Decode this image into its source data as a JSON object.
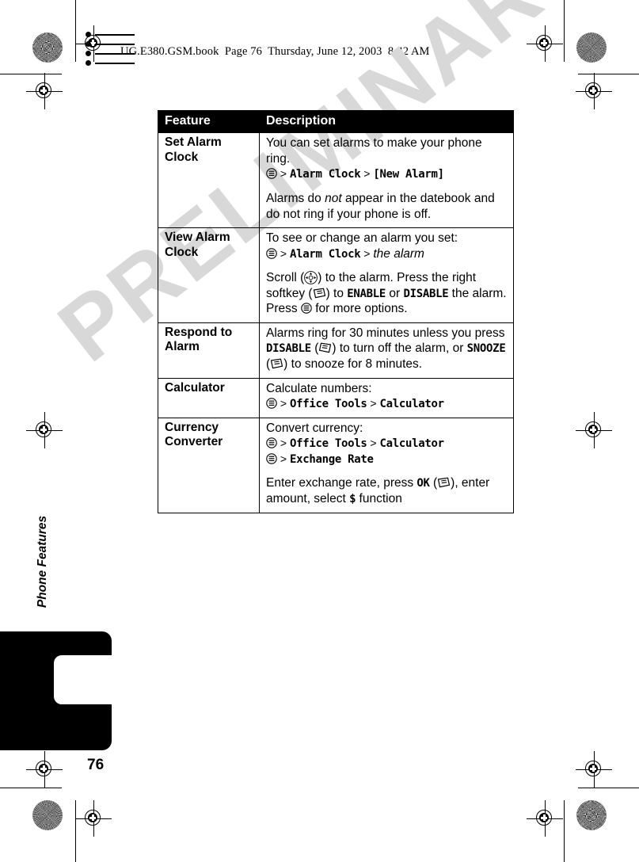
{
  "document": {
    "header_line": "UG.E380.GSM.book  Page 76  Thursday, June 12, 2003  8:42 AM",
    "watermark": "PRELIMINARY",
    "page_number": "76",
    "side_label": "Phone Features"
  },
  "table": {
    "headers": [
      "Feature",
      "Description"
    ],
    "rows": [
      {
        "feature": "Set Alarm Clock",
        "paragraphs": [
          {
            "segments": [
              {
                "type": "text",
                "value": "You can set alarms to make your phone ring."
              },
              {
                "type": "break"
              },
              {
                "type": "icon",
                "value": "menu-icon"
              },
              {
                "type": "sep",
                "value": " > "
              },
              {
                "type": "phone",
                "value": "Alarm Clock"
              },
              {
                "type": "sep",
                "value": " > "
              },
              {
                "type": "phone",
                "value": "[New Alarm]"
              }
            ]
          },
          {
            "segments": [
              {
                "type": "text",
                "value": "Alarms do "
              },
              {
                "type": "italic",
                "value": "not"
              },
              {
                "type": "text",
                "value": " appear in the datebook and do not ring if your phone is off."
              }
            ]
          }
        ]
      },
      {
        "feature": "View Alarm Clock",
        "paragraphs": [
          {
            "segments": [
              {
                "type": "text",
                "value": "To see or change an alarm you set:"
              },
              {
                "type": "break"
              },
              {
                "type": "icon",
                "value": "menu-icon"
              },
              {
                "type": "sep",
                "value": " > "
              },
              {
                "type": "phone",
                "value": "Alarm Clock"
              },
              {
                "type": "sep",
                "value": " > "
              },
              {
                "type": "italic",
                "value": "the alarm"
              }
            ]
          },
          {
            "segments": [
              {
                "type": "text",
                "value": "Scroll ("
              },
              {
                "type": "icon",
                "value": "nav-pad-icon"
              },
              {
                "type": "text",
                "value": ") to the alarm. Press the right softkey ("
              },
              {
                "type": "icon",
                "value": "right-softkey-icon"
              },
              {
                "type": "text",
                "value": ") to "
              },
              {
                "type": "phone",
                "value": "ENABLE"
              },
              {
                "type": "text",
                "value": " or "
              },
              {
                "type": "phone",
                "value": "DISABLE"
              },
              {
                "type": "text",
                "value": " the alarm. Press "
              },
              {
                "type": "icon",
                "value": "menu-icon"
              },
              {
                "type": "text",
                "value": " for more options."
              }
            ]
          }
        ]
      },
      {
        "feature": "Respond to Alarm",
        "paragraphs": [
          {
            "segments": [
              {
                "type": "text",
                "value": "Alarms ring for 30 minutes unless you press"
              },
              {
                "type": "break"
              },
              {
                "type": "phone",
                "value": "DISABLE"
              },
              {
                "type": "text",
                "value": " ("
              },
              {
                "type": "icon",
                "value": "left-softkey-icon"
              },
              {
                "type": "text",
                "value": ") to turn off the alarm, or "
              },
              {
                "type": "phone",
                "value": "SNOOZE"
              },
              {
                "type": "text",
                "value": " ("
              },
              {
                "type": "icon",
                "value": "right-softkey-icon"
              },
              {
                "type": "text",
                "value": ") to snooze for 8 minutes."
              }
            ]
          }
        ]
      },
      {
        "feature": "Calculator",
        "paragraphs": [
          {
            "segments": [
              {
                "type": "text",
                "value": "Calculate numbers:"
              },
              {
                "type": "break"
              },
              {
                "type": "icon",
                "value": "menu-icon"
              },
              {
                "type": "sep",
                "value": " > "
              },
              {
                "type": "phone",
                "value": "Office Tools"
              },
              {
                "type": "sep",
                "value": " > "
              },
              {
                "type": "phone",
                "value": "Calculator"
              }
            ]
          }
        ]
      },
      {
        "feature": "Currency Converter",
        "paragraphs": [
          {
            "segments": [
              {
                "type": "text",
                "value": "Convert currency:"
              },
              {
                "type": "break"
              },
              {
                "type": "icon",
                "value": "menu-icon"
              },
              {
                "type": "sep",
                "value": " > "
              },
              {
                "type": "phone",
                "value": "Office Tools"
              },
              {
                "type": "sep",
                "value": " > "
              },
              {
                "type": "phone",
                "value": "Calculator"
              },
              {
                "type": "break"
              },
              {
                "type": "icon",
                "value": "menu-icon"
              },
              {
                "type": "sep",
                "value": " > "
              },
              {
                "type": "phone",
                "value": "Exchange Rate"
              }
            ]
          },
          {
            "segments": [
              {
                "type": "text",
                "value": "Enter exchange rate, press "
              },
              {
                "type": "phone",
                "value": "OK"
              },
              {
                "type": "text",
                "value": " ("
              },
              {
                "type": "icon",
                "value": "right-softkey-icon"
              },
              {
                "type": "text",
                "value": "), enter amount, select "
              },
              {
                "type": "phone",
                "value": "$"
              },
              {
                "type": "text",
                "value": " function"
              }
            ]
          }
        ]
      }
    ]
  },
  "colors": {
    "ink": "#000000",
    "paper": "#ffffff",
    "watermark": "#d8d8d8"
  }
}
